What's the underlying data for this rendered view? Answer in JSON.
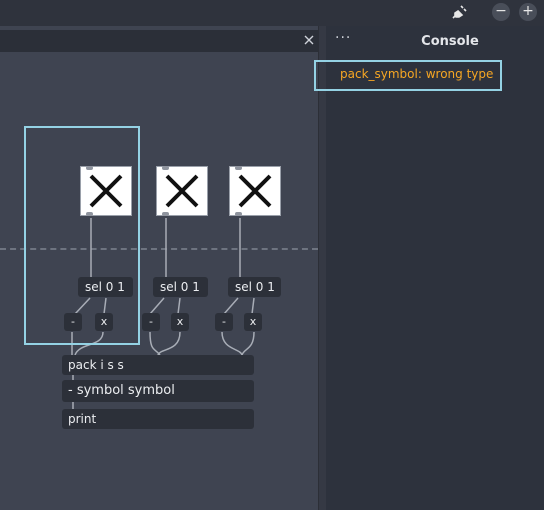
{
  "titlebar": {
    "zoom_out_label": "−",
    "zoom_in_label": "+"
  },
  "search": {
    "value": "",
    "placeholder": ""
  },
  "console": {
    "menu_label": "···",
    "title": "Console",
    "messages": [
      "pack_symbol: wrong type"
    ]
  },
  "patch": {
    "sel_label": "sel 0 1",
    "minus_label": "-",
    "times_label": "x",
    "pack_label": "pack i s s",
    "message_label": "- symbol symbol",
    "print_label": "print"
  },
  "colors": {
    "console_error": "#f6a623",
    "highlight": "#94d2e4",
    "background": "#3f4451"
  }
}
